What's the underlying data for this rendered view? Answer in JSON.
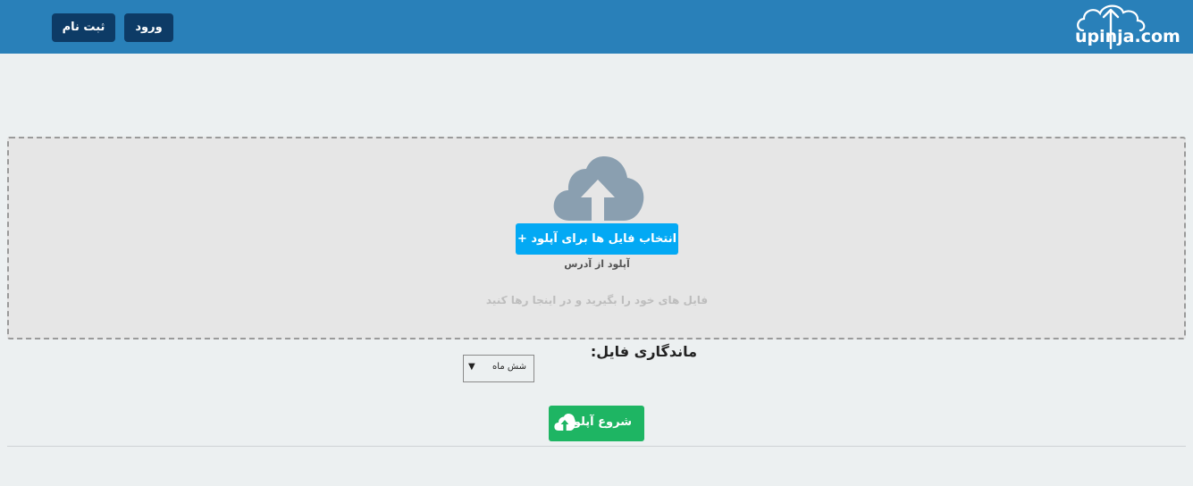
{
  "header": {
    "logo_text": "upinja.com",
    "register_label": "ثبت نام",
    "login_label": "ورود",
    "background_color": "#2980b9",
    "button_color": "#0d3b66"
  },
  "dropzone": {
    "icon": "cloud-upload-icon",
    "choose_files_label": "انتخاب فایل ها برای آپلود +",
    "upload_from_url_label": "آپلود از آدرس",
    "drop_hint": "فایل های خود را بگیرید و در اینجا رها کنید",
    "button_color": "#03a9f4"
  },
  "retention": {
    "label": "ماندگاری فایل:",
    "selected": "شش ماه",
    "arrow": "▼"
  },
  "start": {
    "label": "شروع آپلود",
    "icon": "cloud-upload-icon",
    "color": "#1eb563"
  }
}
